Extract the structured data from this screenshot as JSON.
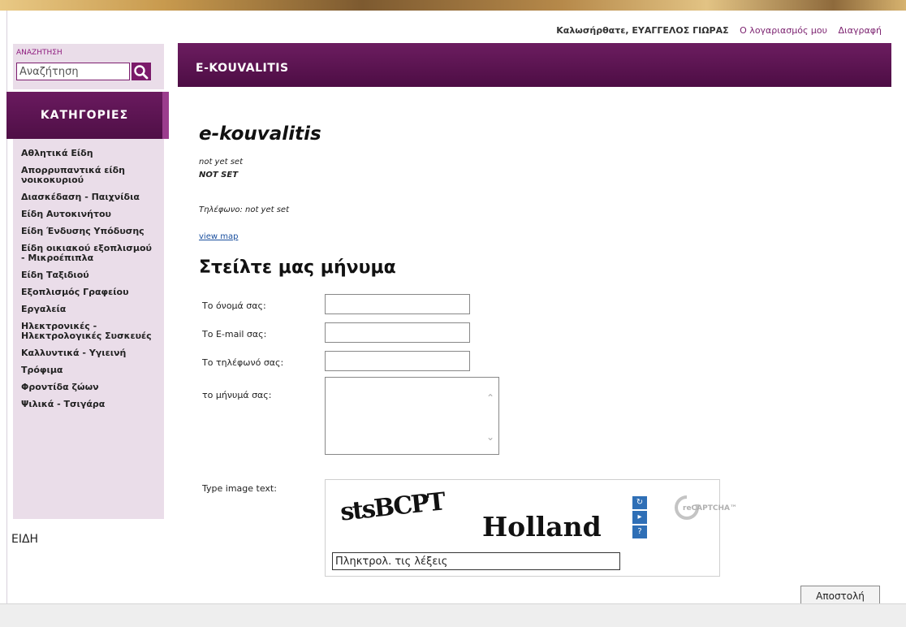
{
  "header": {
    "greeting": "Καλωσήρθατε, ΕΥΑΓΓΕΛΟΣ ΓΙΩΡΑΣ",
    "account_link": "Ο λογαριασμός μου",
    "logout_link": "Διαγραφή"
  },
  "search": {
    "label": "ΑΝΑΖΗΤΗΣΗ",
    "value": "Αναζήτηση"
  },
  "sidebar": {
    "title": "ΚΑΤΗΓΟΡΙΕΣ",
    "items": [
      "Αθλητικά Είδη",
      "Απορρυπαντικά είδη νοικοκυριού",
      "Διασκέδαση - Παιχνίδια",
      "Είδη Αυτοκινήτου",
      "Είδη Ένδυσης Υπόδυσης",
      "Είδη οικιακού εξοπλισμού - Μικροέπιπλα",
      "Είδη Ταξιδιού",
      "Εξοπλισμός Γραφείου",
      "Εργαλεία",
      "Ηλεκτρονικές - Ηλεκτρολογικές Συσκευές",
      "Καλλυντικά - Υγιεινή",
      "Τρόφιμα",
      "Φροντίδα ζώων",
      "Ψιλικά - Τσιγάρα"
    ],
    "footer_label": "ΕΙΔΗ"
  },
  "main": {
    "title_bar": "E-KOUVALITIS",
    "shop_name": "e-kouvalitis",
    "line1": "not yet set",
    "line2": "NOT SET",
    "phone": "Τηλέφωνο: not yet set",
    "view_map": "view map",
    "form_title": "Στείλτε μας μήνυμα"
  },
  "form": {
    "name_label": "Το όνομά σας:",
    "email_label": "Το E-mail σας:",
    "phone_label": "Το τηλέφωνό σας:",
    "message_label": "το μήνυμά σας:",
    "captcha_label": "Type image text:",
    "captcha_word1": "stsBCPT",
    "captcha_word2": "Holland",
    "captcha_input_value": "Πληκτρολ. τις λέξεις",
    "recaptcha_logo": "reCAPTCHA™",
    "submit_label": "Αποστολή"
  },
  "colors": {
    "brand_purple": "#5a1352",
    "sidebar_bg": "#eadde9",
    "link": "#7a1f6e"
  }
}
